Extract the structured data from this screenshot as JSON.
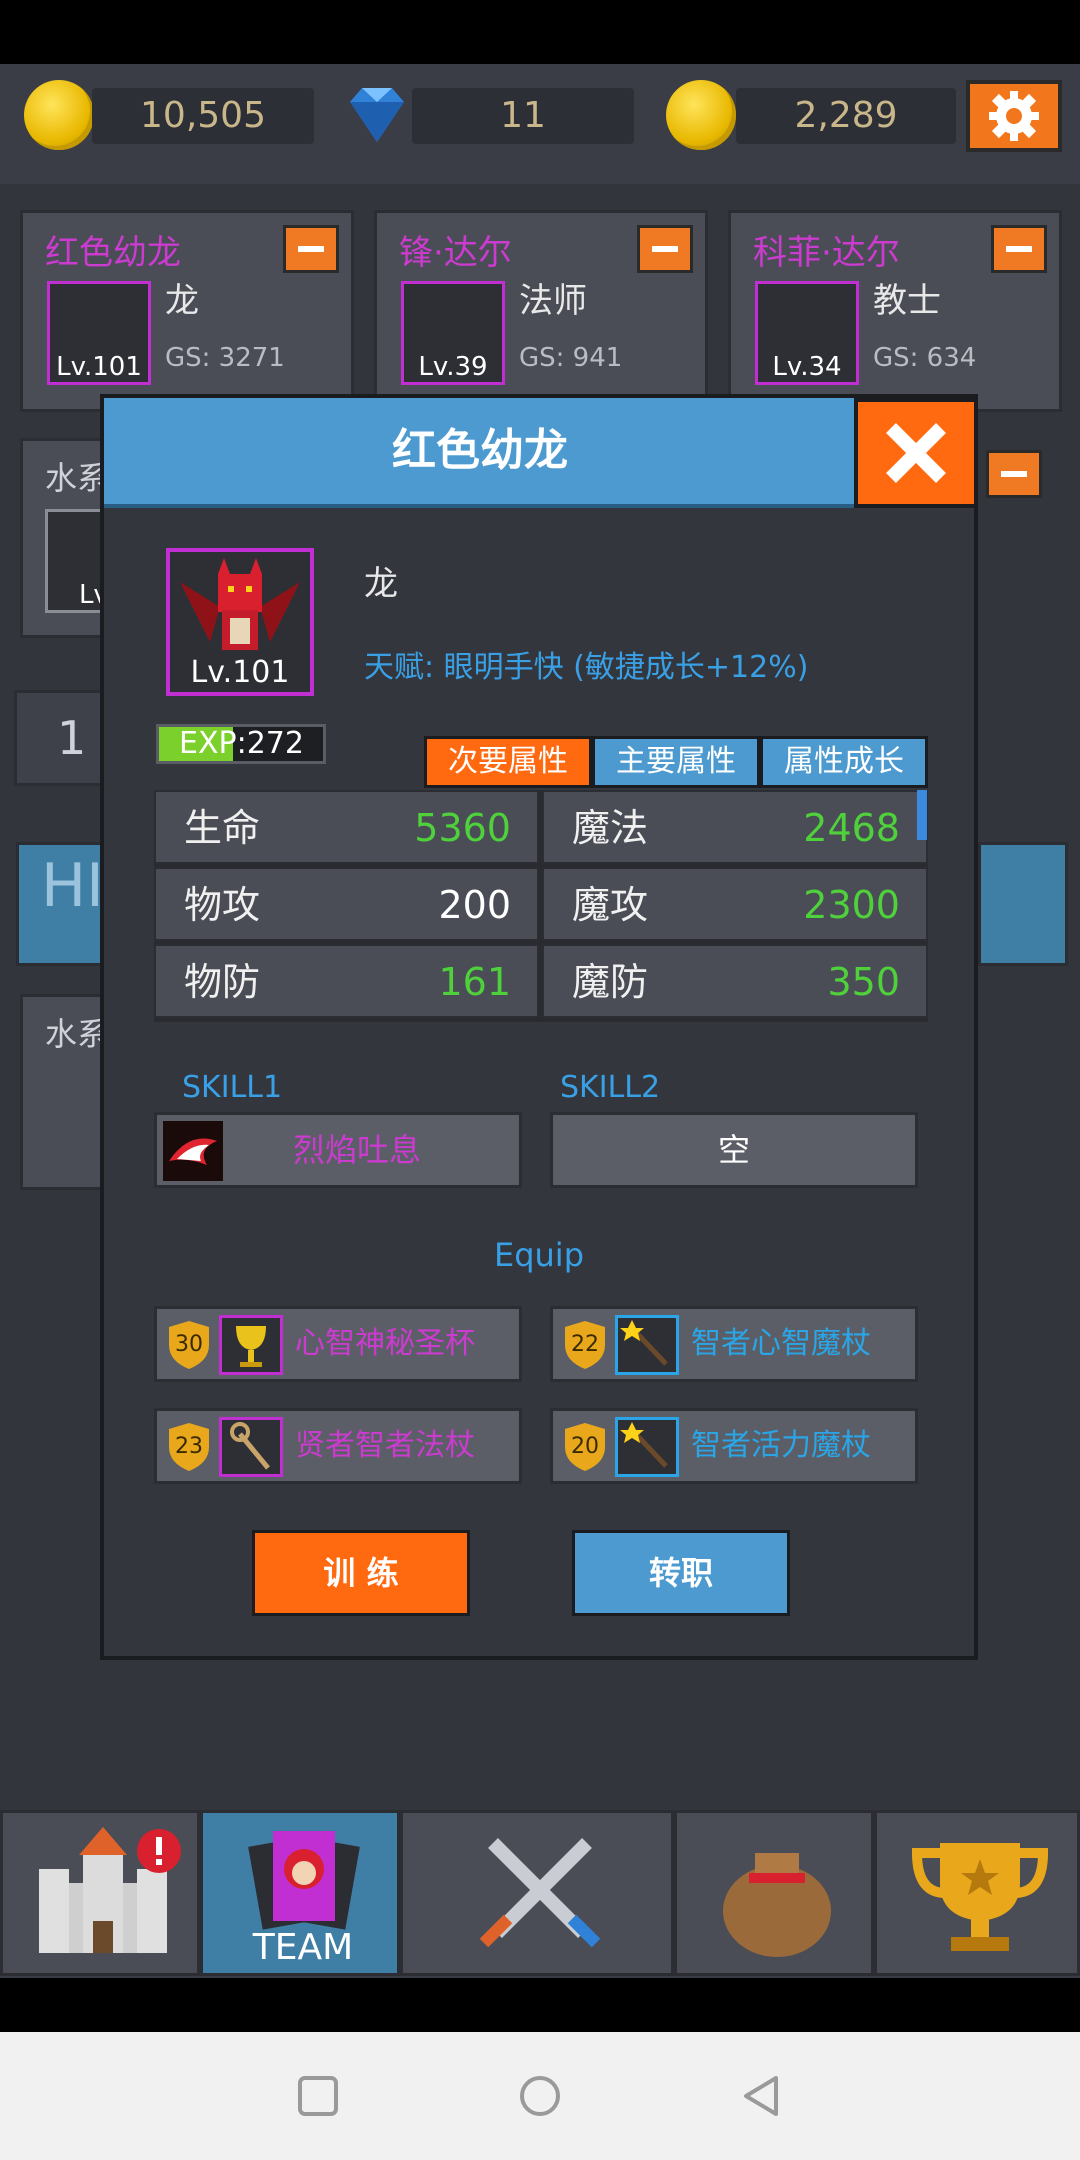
{
  "resources": {
    "gold": "10,505",
    "gems": "11",
    "medals": "2,289"
  },
  "team": [
    {
      "name": "红色幼龙",
      "class": "龙",
      "gs": "GS: 3271",
      "level": "Lv.101"
    },
    {
      "name": "锋·达尔",
      "class": "法师",
      "gs": "GS: 941",
      "level": "Lv.39"
    },
    {
      "name": "科菲·达尔",
      "class": "教士",
      "gs": "GS: 634",
      "level": "Lv.34"
    }
  ],
  "background": {
    "water_label_1": "水系",
    "water_label_2": "水系",
    "count_value": "1",
    "partial_text": "HI",
    "lv_partial": "Lv."
  },
  "modal": {
    "title": "红色幼龙",
    "hero_class": "龙",
    "hero_level": "Lv.101",
    "talent": "天赋: 眼明手快 (敏捷成长+12%)",
    "exp_text": "EXP:272",
    "exp_fraction": 0.45,
    "tabs": [
      "次要属性",
      "主要属性",
      "属性成长"
    ],
    "stats": [
      {
        "label": "生命",
        "value": "5360",
        "color": "#4fd13b"
      },
      {
        "label": "魔法",
        "value": "2468",
        "color": "#4fd13b"
      },
      {
        "label": "物攻",
        "value": "200",
        "color": "#ffffff"
      },
      {
        "label": "魔攻",
        "value": "2300",
        "color": "#4fd13b"
      },
      {
        "label": "物防",
        "value": "161",
        "color": "#4fd13b"
      },
      {
        "label": "魔防",
        "value": "350",
        "color": "#4fd13b"
      }
    ],
    "skill1_label": "SKILL1",
    "skill2_label": "SKILL2",
    "skill1_name": "烈焰吐息",
    "skill2_name": "空",
    "equip_title": "Equip",
    "equips": [
      {
        "level": "30",
        "name": "心智神秘圣杯",
        "color": "#c12fd2",
        "icon": "grail-icon"
      },
      {
        "level": "22",
        "name": "智者心智魔杖",
        "color": "#2aa6e8",
        "icon": "wand-icon"
      },
      {
        "level": "23",
        "name": "贤者智者法杖",
        "color": "#c12fd2",
        "icon": "staff-icon"
      },
      {
        "level": "20",
        "name": "智者活力魔杖",
        "color": "#2aa6e8",
        "icon": "wand-icon"
      }
    ],
    "train_label": "训 练",
    "job_label": "转职"
  },
  "nav": {
    "team_label": "TEAM"
  },
  "colors": {
    "accent_orange": "#ff6a10",
    "accent_blue": "#4c9ad0",
    "purple_name": "#cc3bcf",
    "green_value": "#4fd13b"
  }
}
